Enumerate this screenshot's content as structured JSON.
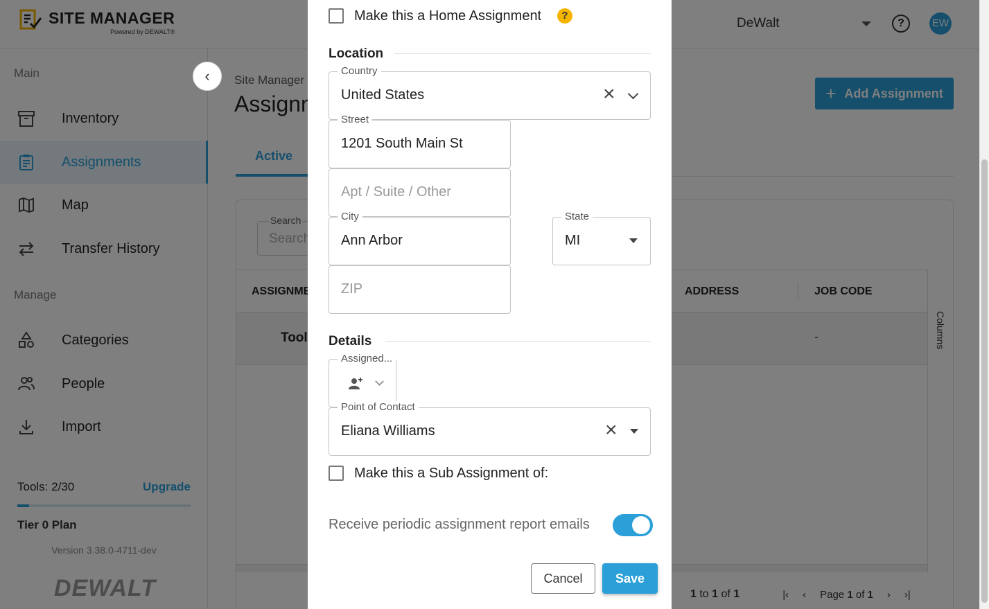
{
  "header": {
    "logo_title": "SITE MANAGER",
    "logo_sub": "Powered by DEWALT®",
    "company": "DeWalt",
    "help_glyph": "?",
    "avatar_initials": "EW"
  },
  "sidebar": {
    "main_section": "Main",
    "manage_section": "Manage",
    "items": [
      {
        "label": "Inventory",
        "icon": "archive-icon"
      },
      {
        "label": "Assignments",
        "icon": "clipboard-icon"
      },
      {
        "label": "Map",
        "icon": "map-icon"
      },
      {
        "label": "Transfer History",
        "icon": "transfer-icon"
      },
      {
        "label": "Categories",
        "icon": "shapes-icon"
      },
      {
        "label": "People",
        "icon": "people-icon"
      },
      {
        "label": "Import",
        "icon": "download-icon"
      }
    ],
    "tools_label": "Tools: 2/30",
    "tools_fraction": 0.0667,
    "upgrade_label": "Upgrade",
    "tier_label": "Tier 0 Plan",
    "version": "Version 3.38.0-4711-dev",
    "footer_brand": "DEWALT"
  },
  "main": {
    "breadcrumb": "Site Manager",
    "page_title": "Assignm",
    "add_button": "Add Assignment",
    "tab_active": "Active",
    "search_label": "Search",
    "search_placeholder": "Search",
    "columns": {
      "assignment": "ASSIGNME",
      "address": "ADDRESS",
      "job_code": "JOB CODE"
    },
    "row": {
      "tool": "Tool",
      "job_code": "-"
    },
    "columns_button": "Columns",
    "pager": {
      "range_a": "1",
      "to": "to",
      "range_b": "1",
      "of": "of",
      "total": "1",
      "page": "Page",
      "page_num": "1",
      "page_of": "of",
      "page_total": "1"
    }
  },
  "modal": {
    "home_assignment_label": "Make this a Home Assignment",
    "help_badge": "?",
    "location_title": "Location",
    "country": {
      "label": "Country",
      "value": "United States"
    },
    "street": {
      "label": "Street",
      "value": "1201 South Main St"
    },
    "apt": {
      "placeholder": "Apt / Suite / Other"
    },
    "city": {
      "label": "City",
      "value": "Ann Arbor"
    },
    "state": {
      "label": "State",
      "value": "MI"
    },
    "zip": {
      "placeholder": "ZIP"
    },
    "details_title": "Details",
    "assigned": {
      "label": "Assigned..."
    },
    "poc": {
      "label": "Point of Contact",
      "value": "Eliana Williams"
    },
    "sub_assignment_label": "Make this a Sub Assignment of:",
    "report_emails_label": "Receive periodic assignment report emails",
    "report_emails_on": true,
    "cancel_label": "Cancel",
    "save_label": "Save"
  },
  "colors": {
    "accent": "#2a9fd8",
    "help_badge": "#f5b400",
    "overlay": "rgba(0,0,0,0.5)"
  }
}
